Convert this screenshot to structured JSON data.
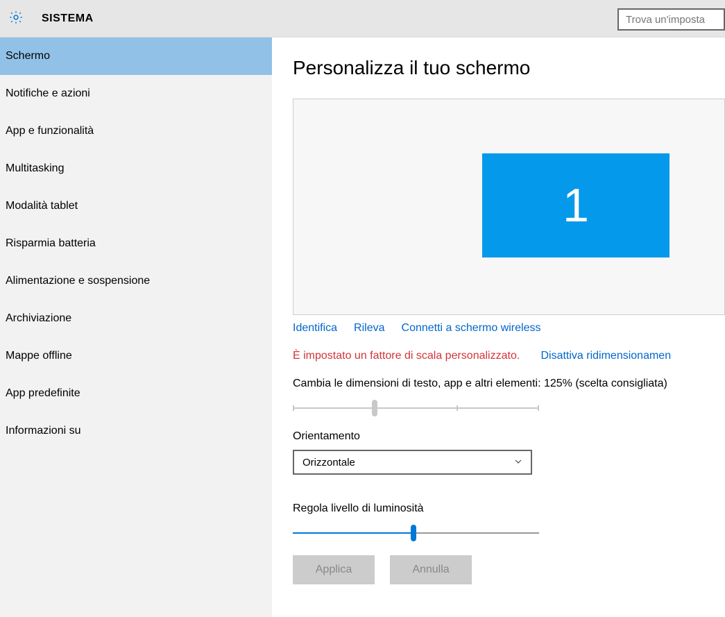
{
  "header": {
    "title": "SISTEMA",
    "search_placeholder": "Trova un'imposta"
  },
  "sidebar": {
    "items": [
      {
        "label": "Schermo",
        "selected": true
      },
      {
        "label": "Notifiche e azioni"
      },
      {
        "label": "App e funzionalità"
      },
      {
        "label": "Multitasking"
      },
      {
        "label": "Modalità tablet"
      },
      {
        "label": "Risparmia batteria"
      },
      {
        "label": "Alimentazione e sospensione"
      },
      {
        "label": "Archiviazione"
      },
      {
        "label": "Mappe offline"
      },
      {
        "label": "App predefinite"
      },
      {
        "label": "Informazioni su"
      }
    ]
  },
  "main": {
    "page_title": "Personalizza il tuo schermo",
    "monitor_number": "1",
    "links": {
      "identify": "Identifica",
      "detect": "Rileva",
      "wireless": "Connetti a schermo wireless"
    },
    "scale_warning": "È impostato un fattore di scala personalizzato.",
    "scale_disable": "Disattiva ridimensionamen",
    "scale_label": "Cambia le dimensioni di testo, app e altri elementi: 125% (scelta consigliata)",
    "orientation_label": "Orientamento",
    "orientation_value": "Orizzontale",
    "brightness_label": "Regola livello di luminosità",
    "apply_label": "Applica",
    "cancel_label": "Annulla"
  }
}
